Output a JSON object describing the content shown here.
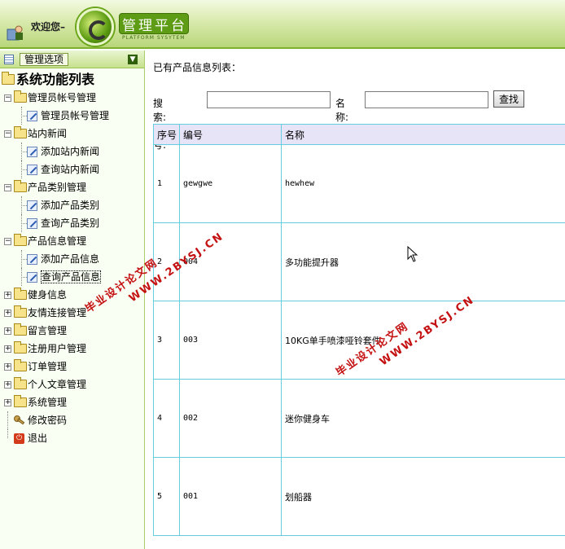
{
  "header": {
    "welcome": "欢迎您–",
    "title": "管理平台",
    "subtitle": "PLATFORM SYSYTEM",
    "user_icon": "user-icon",
    "logo_icon": "logo-icon"
  },
  "sidebar": {
    "head_label": "管理选项",
    "root": "系统功能列表",
    "groups": [
      {
        "label": "管理员帐号管理",
        "children": [
          "管理员帐号管理"
        ]
      },
      {
        "label": "站内新闻",
        "children": [
          "添加站内新闻",
          "查询站内新闻"
        ]
      },
      {
        "label": "产品类别管理",
        "children": [
          "添加产品类别",
          "查询产品类别"
        ]
      },
      {
        "label": "产品信息管理",
        "children": [
          "添加产品信息",
          "查询产品信息"
        ]
      }
    ],
    "collapsed": [
      "健身信息",
      "友情连接管理",
      "留言管理",
      "注册用户管理",
      "订单管理",
      "个人文章管理",
      "系统管理"
    ],
    "change_password": "修改密码",
    "logout": "退出"
  },
  "main": {
    "title": "已有产品信息列表：",
    "search_label": "搜索:编号:",
    "name_label": "名称:",
    "search_button": "查找",
    "table": {
      "headers": [
        "序号",
        "编号",
        "名称"
      ],
      "rows": [
        [
          "1",
          "gewgwe",
          "hewhew"
        ],
        [
          "2",
          "004",
          "多功能提升器"
        ],
        [
          "3",
          "003",
          "10KG单手喷漆哑铃套件"
        ],
        [
          "4",
          "002",
          "迷你健身车"
        ],
        [
          "5",
          "001",
          "划船器"
        ]
      ]
    }
  },
  "watermark": {
    "line1": "毕业设计论文网",
    "line2": "WWW.2BYSJ.CN"
  },
  "colors": {
    "accent": "#7fb02c",
    "table_border": "#66cdde",
    "table_head": "#e8e4f7",
    "watermark": "#c41010"
  }
}
